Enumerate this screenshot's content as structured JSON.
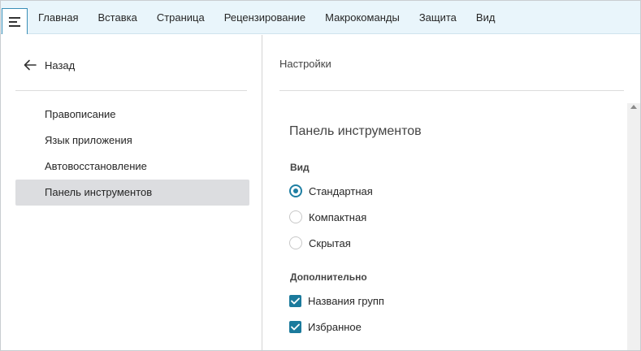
{
  "ribbon": {
    "menu_icon": "hamburger-icon",
    "tabs": [
      "Главная",
      "Вставка",
      "Страница",
      "Рецензирование",
      "Макрокоманды",
      "Защита",
      "Вид"
    ]
  },
  "sidebar": {
    "back_label": "Назад",
    "back_icon": "arrow-left-icon",
    "items": [
      {
        "label": "Правописание",
        "active": false
      },
      {
        "label": "Язык приложения",
        "active": false
      },
      {
        "label": "Автовосстановление",
        "active": false
      },
      {
        "label": "Панель инструментов",
        "active": true
      }
    ]
  },
  "content": {
    "header": "Настройки",
    "section_title": "Панель инструментов",
    "view_group": {
      "label": "Вид",
      "options": [
        {
          "label": "Стандартная",
          "selected": true
        },
        {
          "label": "Компактная",
          "selected": false
        },
        {
          "label": "Скрытая",
          "selected": false
        }
      ]
    },
    "extra_group": {
      "label": "Дополнительно",
      "options": [
        {
          "label": "Названия групп",
          "checked": true
        },
        {
          "label": "Избранное",
          "checked": true
        }
      ]
    }
  },
  "colors": {
    "ribbon_bg": "#e9f5fb",
    "accent": "#1f7fa3",
    "active_nav_bg": "#dcdde0"
  }
}
